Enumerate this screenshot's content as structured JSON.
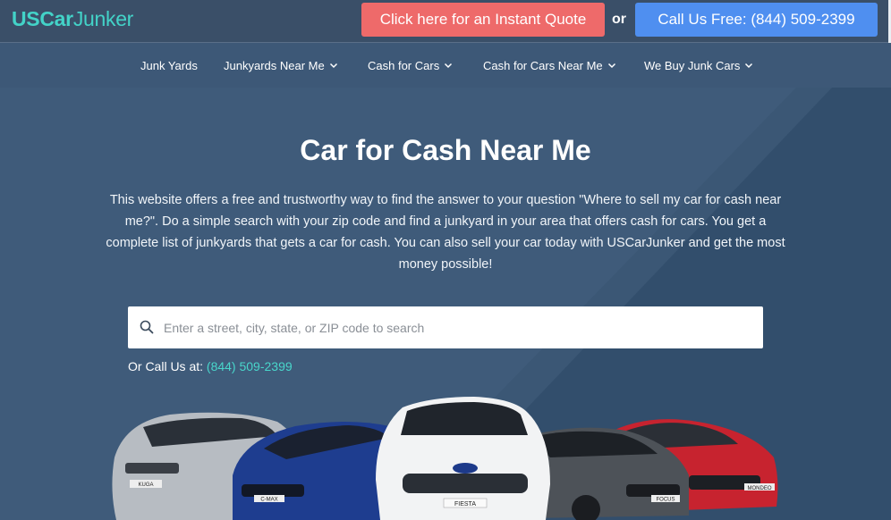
{
  "brand": {
    "logo_bold": "USCar",
    "logo_light": "Junker"
  },
  "header": {
    "quote_button": "Click here for an Instant Quote",
    "or_label": "or",
    "call_button": "Call Us Free: (844) 509-2399"
  },
  "nav": {
    "items": [
      {
        "label": "Junk Yards"
      },
      {
        "label": "Junkyards Near Me"
      },
      {
        "label": "Cash for Cars"
      },
      {
        "label": "Cash for Cars Near Me"
      },
      {
        "label": "We Buy Junk Cars"
      }
    ]
  },
  "hero": {
    "title": "Car for Cash Near Me",
    "description": "This website offers a free and trustworthy way to find the answer to your question \"Where to sell my car for cash near me?\". Do a simple search with your zip code and find a junkyard in your area that offers cash for cars. You get a complete list of junkyards that gets a car for cash. You can also sell your car today with USCarJunker and get the most money possible!",
    "search_placeholder": "Enter a street, city, state, or ZIP code to search",
    "call_prefix": "Or Call Us at: ",
    "call_phone": "(844) 509-2399"
  },
  "cars": {
    "plates": [
      "KUGA",
      "C-MAX",
      "FIESTA",
      "FOCUS",
      "MONDEO"
    ]
  },
  "colors": {
    "accent_teal": "#43d3c8",
    "quote_red": "#ee6a6a",
    "call_blue": "#4f8ff0",
    "header_bg": "#3a4f68",
    "hero_bg": "#3f5b7a"
  }
}
